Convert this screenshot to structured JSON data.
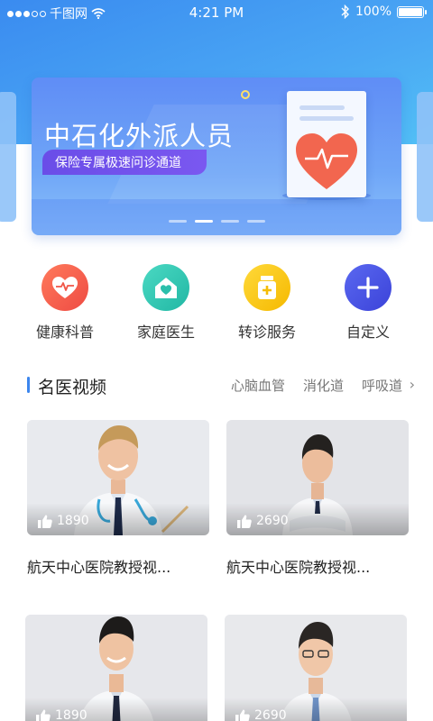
{
  "status_bar": {
    "carrier": "千图网",
    "time": "4:21 PM",
    "battery": "100%"
  },
  "banner": {
    "title": "中石化外派人员",
    "subtitle": "保险专属极速问诊通道",
    "page_count": 4,
    "active_page": 1
  },
  "quick_menu": [
    {
      "label": "健康科普",
      "icon": "heart-pulse-icon",
      "color": "#f15a4a"
    },
    {
      "label": "家庭医生",
      "icon": "home-heart-icon",
      "color": "#2fc6b2"
    },
    {
      "label": "转诊服务",
      "icon": "medicine-bottle-icon",
      "color": "#f7c51e"
    },
    {
      "label": "自定义",
      "icon": "plus-icon",
      "color": "#4a56e8"
    }
  ],
  "videos_section": {
    "title": "名医视频",
    "tabs": [
      "心脑血管",
      "消化道",
      "呼吸道"
    ],
    "cards": [
      {
        "likes": "1890",
        "title": "航天中心医院教授视..."
      },
      {
        "likes": "2690",
        "title": "航天中心医院教授视..."
      },
      {
        "likes": "1890",
        "title": ""
      },
      {
        "likes": "2690",
        "title": ""
      }
    ]
  }
}
